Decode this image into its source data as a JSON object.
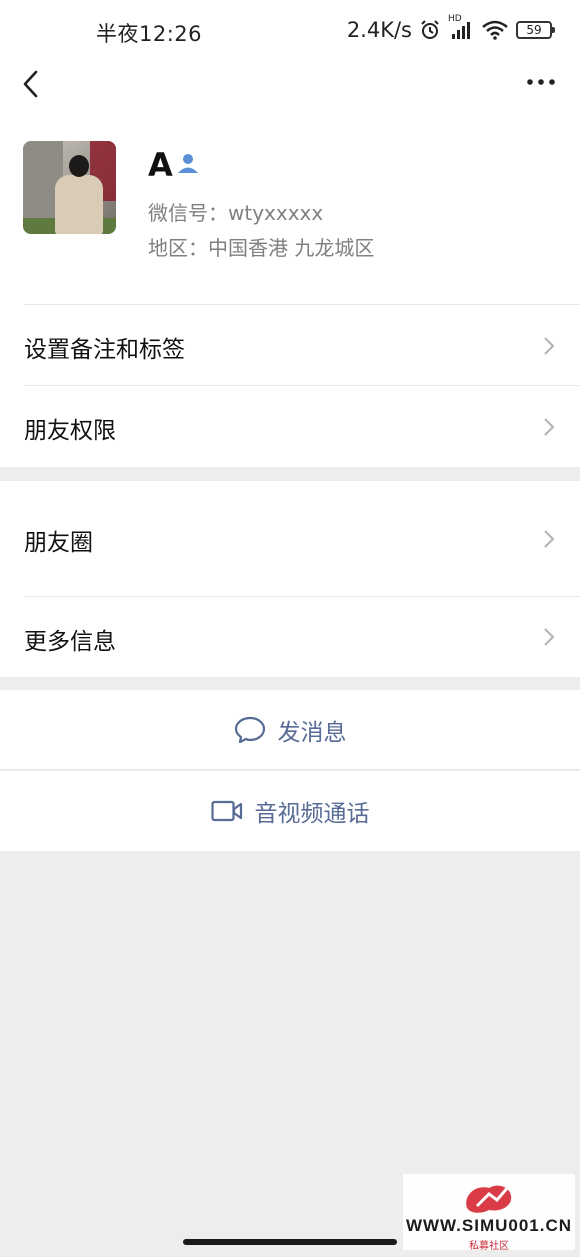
{
  "status_bar": {
    "time": "半夜12:26",
    "net_speed": "2.4K/s",
    "battery": "59",
    "network_label": "HD"
  },
  "nav": {
    "back_icon": "chevron-left-icon",
    "more_icon": "ellipsis-icon"
  },
  "profile": {
    "name": "A",
    "wechat_id": "微信号：wtyxxxxx",
    "region": "地区：中国香港  九龙城区",
    "verified_icon": "person-icon",
    "verified_color": "#5b8fd6"
  },
  "rows": {
    "remark_tags": "设置备注和标签",
    "friend_permissions": "朋友权限",
    "moments": "朋友圈",
    "more_info": "更多信息"
  },
  "actions": {
    "send_message": "发消息",
    "av_call": "音视频通话",
    "accent_color": "#576b95"
  },
  "watermark": {
    "site": "WWW.SIMU001.CN",
    "sub": "私募社区"
  }
}
